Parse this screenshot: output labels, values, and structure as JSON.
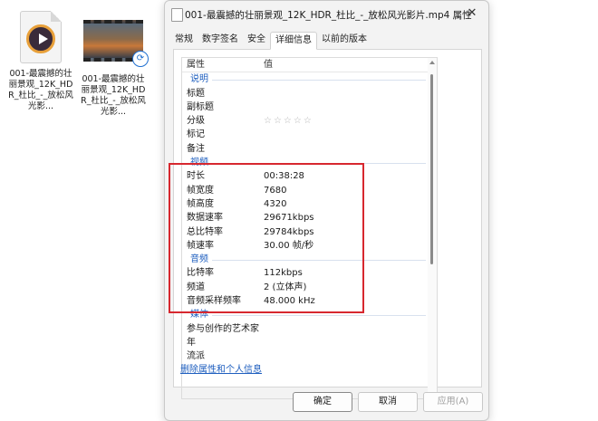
{
  "desktop": {
    "files": [
      {
        "name": "001-最震撼的壮丽景观_12K_HDR_杜比_-_放松风光影..."
      },
      {
        "name": "001-最震撼的壮丽景观_12K_HDR_杜比_-_放松风光影..."
      }
    ]
  },
  "dialog": {
    "title": "001-最震撼的壮丽景观_12K_HDR_杜比_-_放松风光影片.mp4 属性",
    "close_glyph": "✕",
    "tabs": [
      "常规",
      "数字签名",
      "安全",
      "详细信息",
      "以前的版本"
    ],
    "active_tab": "详细信息",
    "columns": {
      "property": "属性",
      "value": "值"
    },
    "sections": {
      "description": {
        "label": "说明",
        "rows": [
          {
            "k": "标题",
            "v": ""
          },
          {
            "k": "副标题",
            "v": ""
          },
          {
            "k": "分级",
            "v": "☆☆☆☆☆"
          },
          {
            "k": "标记",
            "v": ""
          },
          {
            "k": "备注",
            "v": ""
          }
        ]
      },
      "video": {
        "label": "视频",
        "rows": [
          {
            "k": "时长",
            "v": "00:38:28"
          },
          {
            "k": "帧宽度",
            "v": "7680"
          },
          {
            "k": "帧高度",
            "v": "4320"
          },
          {
            "k": "数据速率",
            "v": "29671kbps"
          },
          {
            "k": "总比特率",
            "v": "29784kbps"
          },
          {
            "k": "帧速率",
            "v": "30.00 帧/秒"
          }
        ]
      },
      "audio": {
        "label": "音频",
        "rows": [
          {
            "k": "比特率",
            "v": "112kbps"
          },
          {
            "k": "频道",
            "v": "2 (立体声)"
          },
          {
            "k": "音频采样频率",
            "v": "48.000 kHz"
          }
        ]
      },
      "media": {
        "label": "媒体",
        "rows": [
          {
            "k": "参与创作的艺术家",
            "v": ""
          },
          {
            "k": "年",
            "v": ""
          },
          {
            "k": "流派",
            "v": ""
          }
        ]
      }
    },
    "remove_link": "删除属性和个人信息",
    "buttons": {
      "ok": "确定",
      "cancel": "取消",
      "apply": "应用(A)"
    },
    "highlight_color": "#d7282f"
  }
}
